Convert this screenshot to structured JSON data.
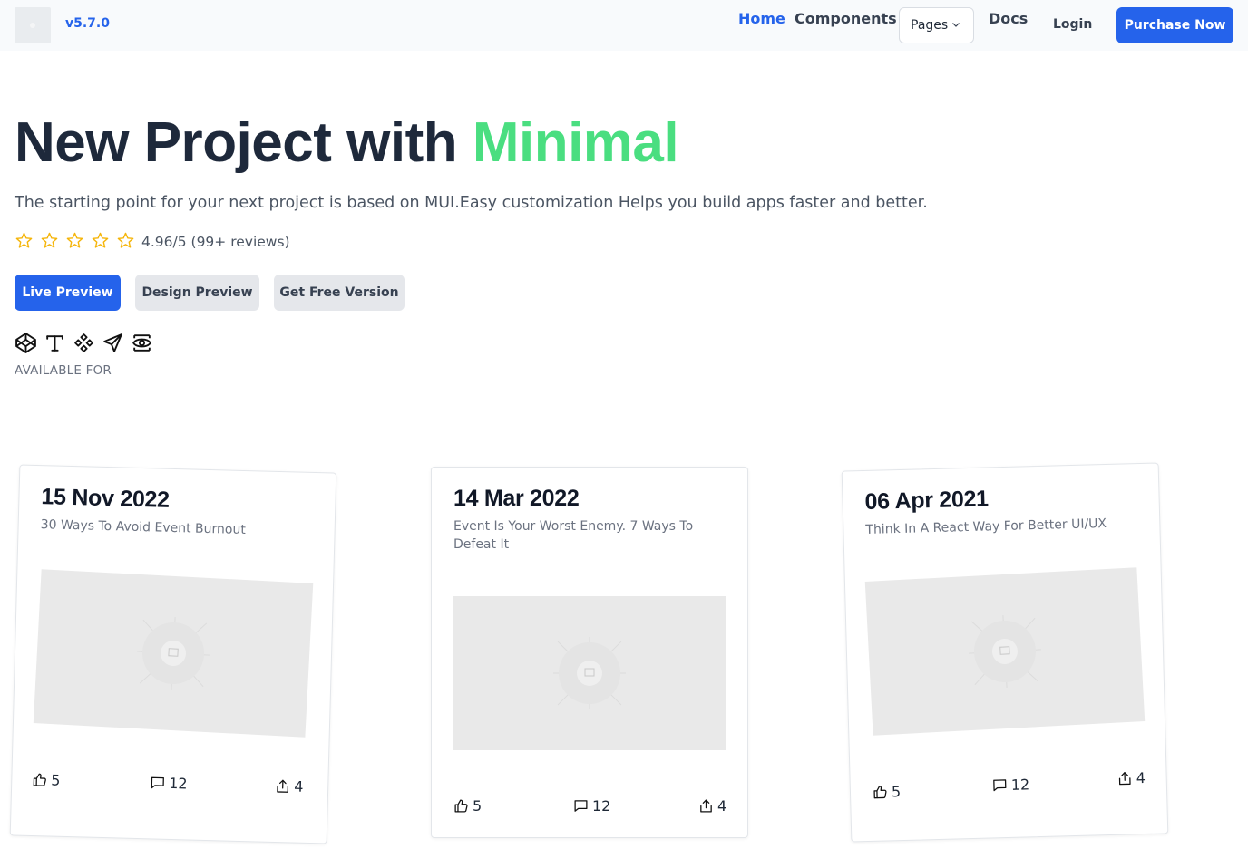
{
  "header": {
    "version": "v5.7.0",
    "nav": {
      "home": "Home",
      "components": "Components",
      "pages": "Pages",
      "docs": "Docs",
      "login": "Login"
    },
    "purchase_label": "Purchase Now",
    "accent_color": "#2563eb"
  },
  "hero": {
    "title_prefix": "New Project with ",
    "title_accent": "Minimal",
    "title_accent_color": "#4ade80",
    "subtitle": "The starting point for your next project is based on MUI.Easy customization Helps you build apps faster and better.",
    "rating_text": "4.96/5 (99+ reviews)",
    "stars_filled": 0,
    "stars_total": 5,
    "buttons": {
      "live": "Live Preview",
      "design": "Design Preview",
      "free": "Get Free Version"
    },
    "available_label": "AVAILABLE FOR",
    "available_icons": [
      "codepen-icon",
      "typescript-icon",
      "figma-icon",
      "send-icon",
      "eye-icon"
    ]
  },
  "cards": [
    {
      "date": "15 Nov 2022",
      "title": "30 Ways To Avoid Event Burnout",
      "likes": "5",
      "comments": "12",
      "shares": "4"
    },
    {
      "date": "14 Mar 2022",
      "title": "Event Is Your Worst Enemy. 7 Ways To Defeat It",
      "likes": "5",
      "comments": "12",
      "shares": "4"
    },
    {
      "date": "06 Apr 2021",
      "title": "Think In A React Way For Better UI/UX",
      "likes": "5",
      "comments": "12",
      "shares": "4"
    }
  ]
}
